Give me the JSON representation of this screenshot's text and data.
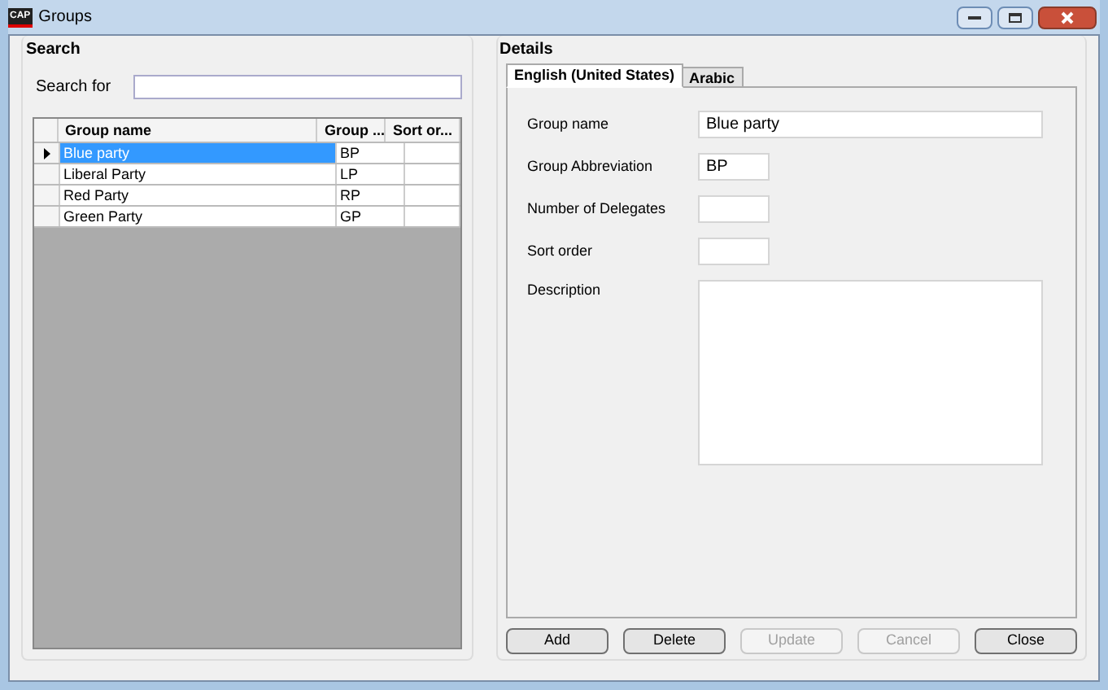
{
  "window": {
    "title": "Groups",
    "logo": "CAP"
  },
  "search": {
    "title": "Search",
    "label": "Search for"
  },
  "table": {
    "columns": [
      "Group name",
      "Group ...",
      "Sort or..."
    ],
    "rows": [
      {
        "cells": [
          "Blue party",
          "BP",
          null
        ],
        "selected": true
      },
      {
        "cells": [
          "Liberal Party",
          "LP",
          null
        ],
        "selected": false
      },
      {
        "cells": [
          "Red Party",
          "RP",
          null
        ],
        "selected": false
      },
      {
        "cells": [
          "Green Party",
          "GP",
          null
        ],
        "selected": false
      }
    ]
  },
  "details": {
    "title": "Details",
    "tabs": [
      {
        "label": "English (United States)",
        "selected": true
      },
      {
        "label": "Arabic",
        "selected": false
      }
    ],
    "fields": [
      {
        "label": "Group name",
        "value": "Blue party",
        "kind": "wide"
      },
      {
        "label": "Group Abbreviation",
        "value": "BP",
        "kind": "short"
      },
      {
        "label": "Number of Delegates",
        "kind": "short"
      },
      {
        "label": "Sort order",
        "kind": "short"
      },
      {
        "label": "Description",
        "kind": "area"
      }
    ]
  },
  "buttons": [
    {
      "label": "Add",
      "disabled": false
    },
    {
      "label": "Delete",
      "disabled": false
    },
    {
      "label": "Update",
      "disabled": true
    },
    {
      "label": "Cancel",
      "disabled": true
    },
    {
      "label": "Close",
      "disabled": false
    }
  ]
}
